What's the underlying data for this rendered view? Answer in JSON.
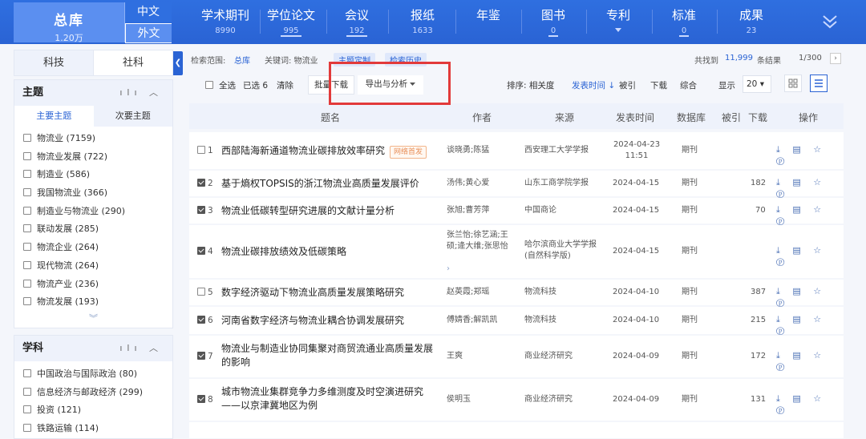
{
  "nav": {
    "zongku": {
      "label": "总库",
      "count": "1.20万"
    },
    "lang_zh": "中文",
    "lang_en": "外文",
    "items": [
      {
        "label": "学术期刊",
        "count": "8990"
      },
      {
        "label": "学位论文",
        "count": "995"
      },
      {
        "label": "会议",
        "count": "192"
      },
      {
        "label": "报纸",
        "count": "1633"
      },
      {
        "label": "年鉴",
        "count": ""
      },
      {
        "label": "图书",
        "count": "0"
      },
      {
        "label": "专利",
        "count": ""
      },
      {
        "label": "标准",
        "count": "0"
      },
      {
        "label": "成果",
        "count": "23"
      }
    ]
  },
  "sidebar": {
    "tabs": [
      "科技",
      "社科"
    ],
    "topic_panel": {
      "title": "主题",
      "subtabs": [
        "主要主题",
        "次要主题"
      ],
      "items": [
        "物流业 (7159)",
        "物流业发展 (722)",
        "制造业 (586)",
        "我国物流业 (366)",
        "制造业与物流业 (290)",
        "联动发展 (285)",
        "物流企业 (264)",
        "现代物流 (264)",
        "物流产业 (236)",
        "物流发展 (193)"
      ]
    },
    "subject_panel": {
      "title": "学科",
      "items": [
        "中国政治与国际政治 (80)",
        "信息经济与邮政经济 (299)",
        "投资 (121)",
        "铁路运输 (114)"
      ]
    }
  },
  "scope": {
    "label": "检索范围:",
    "db": "总库",
    "keyword": "关键词: 物流业",
    "custom_btn": "主题定制",
    "history_btn": "检索历史",
    "found_label": "共找到",
    "found_count": "11,999",
    "found_unit": "条结果",
    "page": "1/300"
  },
  "toolbar": {
    "select_all": "全选",
    "selected": "已选",
    "selected_count": "6",
    "clear": "清除",
    "batch_download": "批量下载",
    "export_analyze": "导出与分析",
    "sort_label": "排序: 相关度",
    "sort_pubtime": "发表时间",
    "sort_cited": "被引",
    "sort_download": "下载",
    "sort_overall": "综合",
    "display_label": "显示",
    "display_count": "20"
  },
  "table": {
    "headers": [
      "题名",
      "作者",
      "来源",
      "发表时间",
      "数据库",
      "被引",
      "下载",
      "操作"
    ],
    "rows": [
      {
        "idx": "1",
        "checked": false,
        "title": "西部陆海新通道物流业碳排放效率研究",
        "badge": "网络首发",
        "authors": "谈晓勇;陈猛",
        "source": "西安理工大学学报",
        "date": "2024-04-23",
        "date2": "11:51",
        "db": "期刊",
        "cited": "",
        "downloads": ""
      },
      {
        "idx": "2",
        "checked": true,
        "title": "基于熵权TOPSIS的浙江物流业高质量发展评价",
        "badge": "",
        "authors": "汤伟;黄心爱",
        "source": "山东工商学院学报",
        "date": "2024-04-15",
        "date2": "",
        "db": "期刊",
        "cited": "",
        "downloads": "182"
      },
      {
        "idx": "3",
        "checked": true,
        "title": "物流业低碳转型研究进展的文献计量分析",
        "badge": "",
        "authors": "张旭;曹芳萍",
        "source": "中国商论",
        "date": "2024-04-15",
        "date2": "",
        "db": "期刊",
        "cited": "",
        "downloads": "70"
      },
      {
        "idx": "4",
        "checked": true,
        "title": "物流业碳排放绩效及低碳策略",
        "badge": "",
        "authors": "张兰怡;徐艺涵;王硕;逄大维;张思怡",
        "source": "哈尔滨商业大学学报(自然科学版)",
        "date": "2024-04-15",
        "date2": "",
        "db": "期刊",
        "cited": "",
        "downloads": ""
      },
      {
        "idx": "5",
        "checked": false,
        "title": "数字经济驱动下物流业高质量发展策略研究",
        "badge": "",
        "authors": "赵英霞;郑瑶",
        "source": "物流科技",
        "date": "2024-04-10",
        "date2": "",
        "db": "期刊",
        "cited": "",
        "downloads": "387"
      },
      {
        "idx": "6",
        "checked": true,
        "title": "河南省数字经济与物流业耦合协调发展研究",
        "badge": "",
        "authors": "傅婧香;解凯凯",
        "source": "物流科技",
        "date": "2024-04-10",
        "date2": "",
        "db": "期刊",
        "cited": "",
        "downloads": "215"
      },
      {
        "idx": "7",
        "checked": true,
        "title": "物流业与制造业协同集聚对商贸流通业高质量发展的影响",
        "badge": "",
        "authors": "王爽",
        "source": "商业经济研究",
        "date": "2024-04-09",
        "date2": "",
        "db": "期刊",
        "cited": "",
        "downloads": "172"
      },
      {
        "idx": "8",
        "checked": true,
        "title": "城市物流业集群竞争力多维测度及时空演进研究——以京津冀地区为例",
        "badge": "",
        "authors": "侯明玉",
        "source": "商业经济研究",
        "date": "2024-04-09",
        "date2": "",
        "db": "期刊",
        "cited": "",
        "downloads": "131"
      }
    ]
  }
}
